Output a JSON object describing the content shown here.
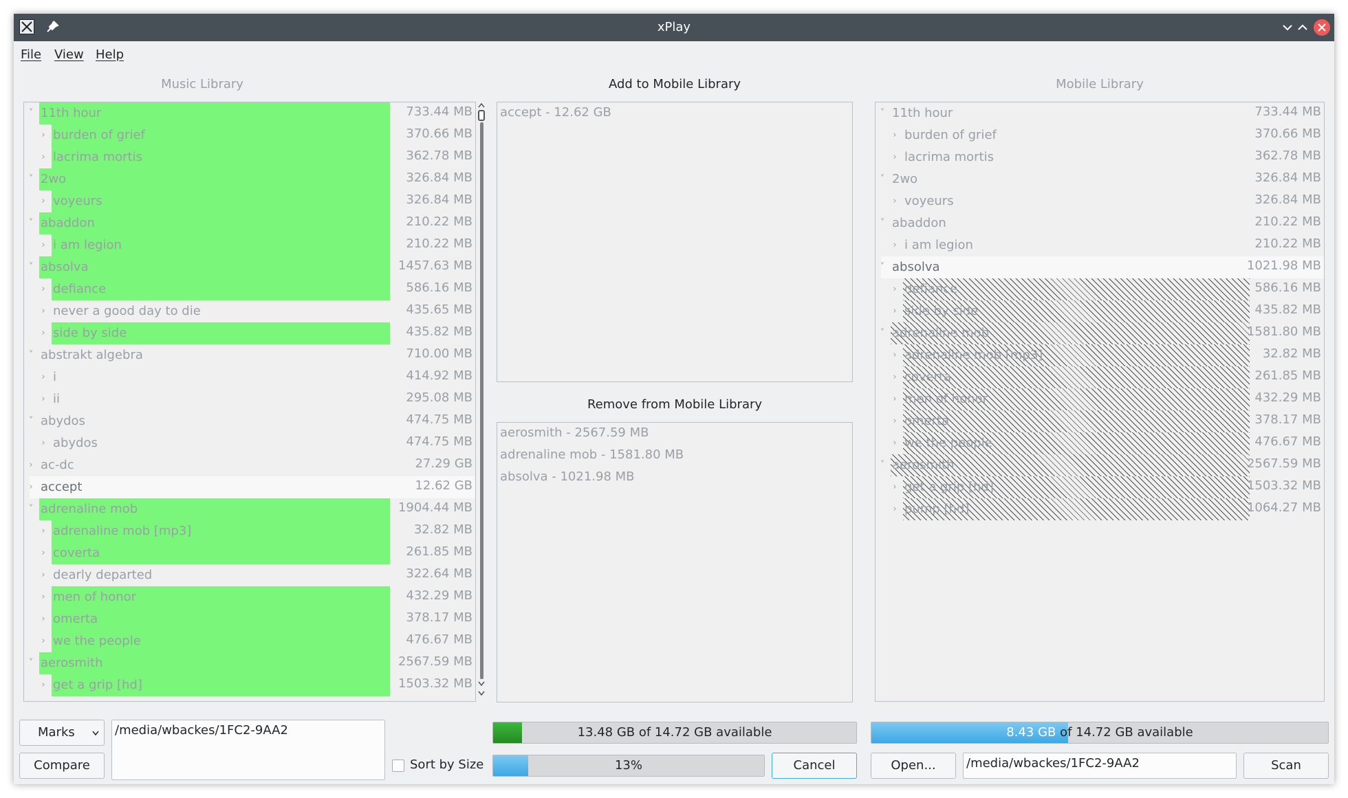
{
  "window": {
    "title": "xPlay"
  },
  "menu": [
    "File",
    "View",
    "Help"
  ],
  "music_library": {
    "title": "Music Library",
    "rows": [
      {
        "level": 0,
        "name": "11th hour",
        "size": "733.44 MB",
        "expanded": true,
        "highlight": true
      },
      {
        "level": 1,
        "name": "burden of grief",
        "size": "370.66 MB",
        "highlight": true
      },
      {
        "level": 1,
        "name": "lacrima mortis",
        "size": "362.78 MB",
        "highlight": true
      },
      {
        "level": 0,
        "name": "2wo",
        "size": "326.84 MB",
        "expanded": true,
        "highlight": true
      },
      {
        "level": 1,
        "name": "voyeurs",
        "size": "326.84 MB",
        "highlight": true
      },
      {
        "level": 0,
        "name": "abaddon",
        "size": "210.22 MB",
        "expanded": true,
        "highlight": true
      },
      {
        "level": 1,
        "name": "i am legion",
        "size": "210.22 MB",
        "highlight": true
      },
      {
        "level": 0,
        "name": "absolva",
        "size": "1457.63 MB",
        "expanded": true,
        "highlight": true
      },
      {
        "level": 1,
        "name": "defiance",
        "size": "586.16 MB",
        "highlight": true
      },
      {
        "level": 1,
        "name": "never a good day to die",
        "size": "435.65 MB",
        "highlight": false
      },
      {
        "level": 1,
        "name": "side by side",
        "size": "435.82 MB",
        "highlight": true
      },
      {
        "level": 0,
        "name": "abstrakt algebra",
        "size": "710.00 MB",
        "expanded": true,
        "highlight": false
      },
      {
        "level": 1,
        "name": "i",
        "size": "414.92 MB",
        "highlight": false
      },
      {
        "level": 1,
        "name": "ii",
        "size": "295.08 MB",
        "highlight": false
      },
      {
        "level": 0,
        "name": "abydos",
        "size": "474.75 MB",
        "expanded": true,
        "highlight": false
      },
      {
        "level": 1,
        "name": "abydos",
        "size": "474.75 MB",
        "highlight": false
      },
      {
        "level": 0,
        "name": "ac-dc",
        "size": "27.29 GB",
        "expanded": false,
        "highlight": false
      },
      {
        "level": 0,
        "name": "accept",
        "size": "12.62 GB",
        "expanded": false,
        "highlight": false,
        "current": true
      },
      {
        "level": 0,
        "name": "adrenaline mob",
        "size": "1904.44 MB",
        "expanded": true,
        "highlight": true
      },
      {
        "level": 1,
        "name": "adrenaline mob [mp3]",
        "size": "32.82 MB",
        "highlight": true
      },
      {
        "level": 1,
        "name": "coverta",
        "size": "261.85 MB",
        "highlight": true
      },
      {
        "level": 1,
        "name": "dearly departed",
        "size": "322.64 MB",
        "highlight": false
      },
      {
        "level": 1,
        "name": "men of honor",
        "size": "432.29 MB",
        "highlight": true
      },
      {
        "level": 1,
        "name": "omerta",
        "size": "378.17 MB",
        "highlight": true
      },
      {
        "level": 1,
        "name": "we the people",
        "size": "476.67 MB",
        "highlight": true
      },
      {
        "level": 0,
        "name": "aerosmith",
        "size": "2567.59 MB",
        "expanded": true,
        "highlight": true
      },
      {
        "level": 1,
        "name": "get a grip [hd]",
        "size": "1503.32 MB",
        "highlight": true
      }
    ]
  },
  "add_panel": {
    "title": "Add to Mobile Library",
    "items": [
      "accept - 12.62 GB"
    ]
  },
  "remove_panel": {
    "title": "Remove from Mobile Library",
    "items": [
      "aerosmith - 2567.59 MB",
      "adrenaline mob - 1581.80 MB",
      "absolva - 1021.98 MB"
    ]
  },
  "mobile_library": {
    "title": "Mobile Library",
    "rows": [
      {
        "level": 0,
        "name": "11th hour",
        "size": "733.44 MB",
        "expanded": true
      },
      {
        "level": 1,
        "name": "burden of grief",
        "size": "370.66 MB"
      },
      {
        "level": 1,
        "name": "lacrima mortis",
        "size": "362.78 MB"
      },
      {
        "level": 0,
        "name": "2wo",
        "size": "326.84 MB",
        "expanded": true
      },
      {
        "level": 1,
        "name": "voyeurs",
        "size": "326.84 MB"
      },
      {
        "level": 0,
        "name": "abaddon",
        "size": "210.22 MB",
        "expanded": true
      },
      {
        "level": 1,
        "name": "i am legion",
        "size": "210.22 MB"
      },
      {
        "level": 0,
        "name": "absolva",
        "size": "1021.98 MB",
        "expanded": true,
        "current": true
      },
      {
        "level": 1,
        "name": "defiance",
        "size": "586.16 MB",
        "removed": true
      },
      {
        "level": 1,
        "name": "side by side",
        "size": "435.82 MB",
        "removed": true
      },
      {
        "level": 0,
        "name": "adrenaline mob",
        "size": "1581.80 MB",
        "expanded": true,
        "removed": true
      },
      {
        "level": 1,
        "name": "adrenaline mob [mp3]",
        "size": "32.82 MB",
        "removed": true
      },
      {
        "level": 1,
        "name": "coverta",
        "size": "261.85 MB",
        "removed": true
      },
      {
        "level": 1,
        "name": "men of honor",
        "size": "432.29 MB",
        "removed": true
      },
      {
        "level": 1,
        "name": "omerta",
        "size": "378.17 MB",
        "removed": true
      },
      {
        "level": 1,
        "name": "we the people",
        "size": "476.67 MB",
        "removed": true
      },
      {
        "level": 0,
        "name": "aerosmith",
        "size": "2567.59 MB",
        "expanded": true,
        "removed": true
      },
      {
        "level": 1,
        "name": "get a grip [hd]",
        "size": "1503.32 MB",
        "removed": true
      },
      {
        "level": 1,
        "name": "pump [hd]",
        "size": "1064.27 MB",
        "removed": true
      }
    ]
  },
  "bottom": {
    "marks_label": "Marks",
    "compare_label": "Compare",
    "music_path": "/media/wbackes/1FC2-9AA2",
    "sort_by_size_label": "Sort by Size",
    "sort_by_size_checked": false,
    "space_text": "13.48 GB of 14.72 GB available",
    "space_fraction": 0.08,
    "task_progress_text": "13%",
    "task_progress_fraction": 0.13,
    "cancel_label": "Cancel",
    "mobile_used_value": "8.43 GB",
    "mobile_used_rest": "of 14.72 GB available",
    "mobile_used_fraction": 0.43,
    "open_label": "Open...",
    "mobile_path": "/media/wbackes/1FC2-9AA2",
    "scan_label": "Scan"
  },
  "colors": {
    "highlight": "#7af77a",
    "titlebar": "#475057",
    "accent": "#3daee9",
    "space_fill": "#2e9e2e"
  }
}
